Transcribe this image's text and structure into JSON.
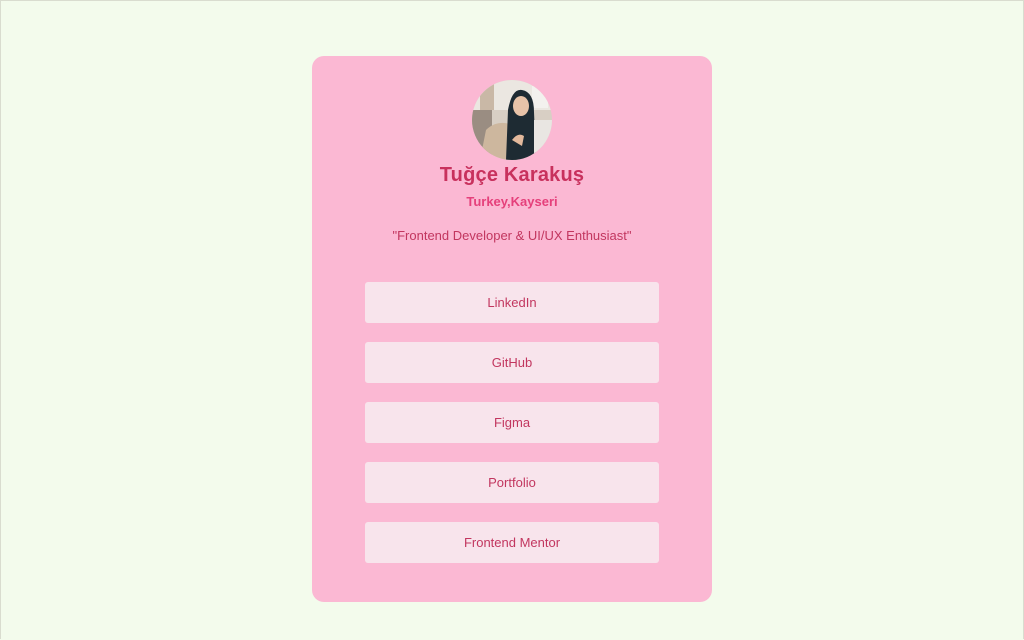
{
  "profile": {
    "name": "Tuğçe Karakuş",
    "location": "Turkey,Kayseri",
    "tagline": "\"Frontend Developer & UI/UX Enthusiast\""
  },
  "links": [
    {
      "label": "LinkedIn"
    },
    {
      "label": "GitHub"
    },
    {
      "label": "Figma"
    },
    {
      "label": "Portfolio"
    },
    {
      "label": "Frontend Mentor"
    }
  ],
  "colors": {
    "page_background": "#f3fbec",
    "card_background": "#fbb8d3",
    "name_color": "#c8315d",
    "location_color": "#e5407b",
    "button_background": "#f8e4ec",
    "button_text": "#c2365f"
  }
}
